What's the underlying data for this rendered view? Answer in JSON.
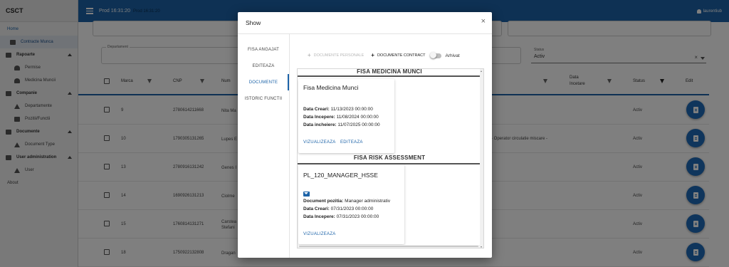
{
  "app": {
    "brand": "CSCT",
    "env_title": "Prod 16:31:20",
    "env_badge": "Prod 16:31:20",
    "user": "laurentiub"
  },
  "sidebar": {
    "items": [
      {
        "label": "Home",
        "kind": "top",
        "icon": ""
      },
      {
        "label": "Contracte Munca",
        "kind": "active",
        "icon": "contract-icon"
      },
      {
        "label": "Rapoarte",
        "kind": "group",
        "icon": "reports-icon"
      },
      {
        "label": "Permise",
        "kind": "sub",
        "icon": "person-icon"
      },
      {
        "label": "Medicina Muncii",
        "kind": "sub",
        "icon": "person-icon"
      },
      {
        "label": "Companie",
        "kind": "group",
        "icon": "company-icon"
      },
      {
        "label": "Departamente",
        "kind": "sub",
        "icon": "home-icon"
      },
      {
        "label": "Pozitii/Functii",
        "kind": "sub",
        "icon": "position-icon"
      },
      {
        "label": "Documente",
        "kind": "group",
        "icon": "document-icon"
      },
      {
        "label": "Document Type",
        "kind": "sub",
        "icon": "upload-icon"
      },
      {
        "label": "User administration",
        "kind": "group",
        "icon": "admin-icon"
      },
      {
        "label": "User",
        "kind": "sub",
        "icon": "upload-icon"
      },
      {
        "label": "About",
        "kind": "top",
        "icon": ""
      }
    ]
  },
  "filters": {
    "departament_label": "Departament",
    "status_label": "Status",
    "status_value": "Activ",
    "clear": "×"
  },
  "table": {
    "headers": {
      "marca": "Marca",
      "cnp": "CNP",
      "nume": "Num",
      "data_incetare": "Data\nIncetare",
      "status": "Status",
      "edit": "Edit"
    },
    "rows": [
      {
        "marca": "9",
        "cnp": "2780614211668",
        "name": "Nita Ma",
        "extra": "",
        "status": "Activ"
      },
      {
        "marca": "10",
        "cnp": "1790305131265",
        "name": "Lupes E",
        "extra": "- Operator circulatie miscare -",
        "status": "Activ"
      },
      {
        "marca": "13",
        "cnp": "2780916131242",
        "name": "Genes I",
        "extra": "",
        "status": "Activ"
      },
      {
        "marca": "14",
        "cnp": "1690926131213",
        "name": "Ciolme",
        "extra": "",
        "status": "Activ"
      },
      {
        "marca": "15",
        "cnp": "1760814131271",
        "name": "Carstea\nStefani",
        "extra": "",
        "status": "Activ"
      },
      {
        "marca": "18",
        "cnp": "1750922132808",
        "name": "Dragan",
        "extra": "",
        "status": "Activ"
      }
    ]
  },
  "modal": {
    "title": "Show",
    "close": "×",
    "tabs": [
      "FISA ANGAJAT",
      "EDITEAZA",
      "DOCUMENTE",
      "ISTORIC FUNCTII"
    ],
    "active_tab": 2,
    "toolbar": {
      "personal": "DOCUMENTE PERSONALE",
      "contract": "DOCUMENTE CONTRACT",
      "archived": "Arhivat"
    },
    "sections": [
      {
        "title": "FISA MEDICINA MUNCI",
        "card": {
          "title": "Fisa Medicina Munci",
          "lines": [
            {
              "label": "Data Creari:",
              "value": "11/13/2023 00:00:00"
            },
            {
              "label": "Data Incepere:",
              "value": "11/08/2024 00:00:00"
            },
            {
              "label": "Data incheiere:",
              "value": "11/07/2025 00:00:00"
            }
          ],
          "actions": [
            "VIZUALIZEAZA",
            "EDITEAZA"
          ]
        }
      },
      {
        "title": "FISA RISK ASSESSMENT",
        "card": {
          "title": "PL_120_MANAGER_HSSE",
          "lines": [
            {
              "label": "Document pozitia:",
              "value": "Manager administrativ"
            },
            {
              "label": "Data Creari:",
              "value": "07/31/2023 00:00:00"
            },
            {
              "label": "Data Incepere:",
              "value": "07/31/2023 00:00:00"
            }
          ],
          "actions": [
            "VIZUALIZEAZA"
          ]
        }
      }
    ]
  }
}
